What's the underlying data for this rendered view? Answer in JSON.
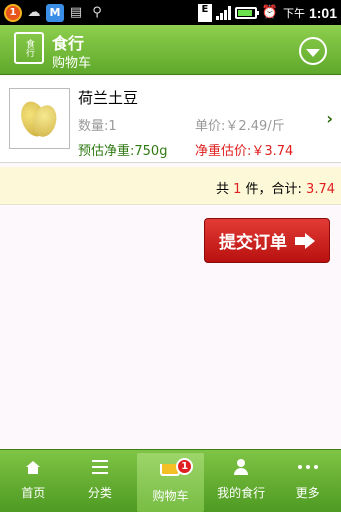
{
  "status_bar": {
    "notification_count": "1",
    "m_icon_label": "M",
    "e_label": "E",
    "time_period": "下午",
    "time": "1:01"
  },
  "header": {
    "logo_text": "食行",
    "title": "食行",
    "subtitle": "购物车"
  },
  "cart": {
    "items": [
      {
        "name": "荷兰土豆",
        "quantity": "数量:1",
        "unit_price": "单价:￥2.49/斤",
        "estimated_weight": "预估净重:750g",
        "estimated_price": "净重估价:￥3.74"
      }
    ],
    "summary": {
      "prefix": "共",
      "count": "1",
      "middle": "件，合计:",
      "total": "3.74"
    }
  },
  "submit_label": "提交订单",
  "bottom_nav": {
    "items": [
      {
        "label": "首页"
      },
      {
        "label": "分类"
      },
      {
        "label": "购物车",
        "badge": "1"
      },
      {
        "label": "我的食行"
      },
      {
        "label": "更多"
      }
    ]
  },
  "colors": {
    "brand_green": "#5fa82a",
    "price_red": "#e02020",
    "weight_green": "#2f7a13"
  }
}
